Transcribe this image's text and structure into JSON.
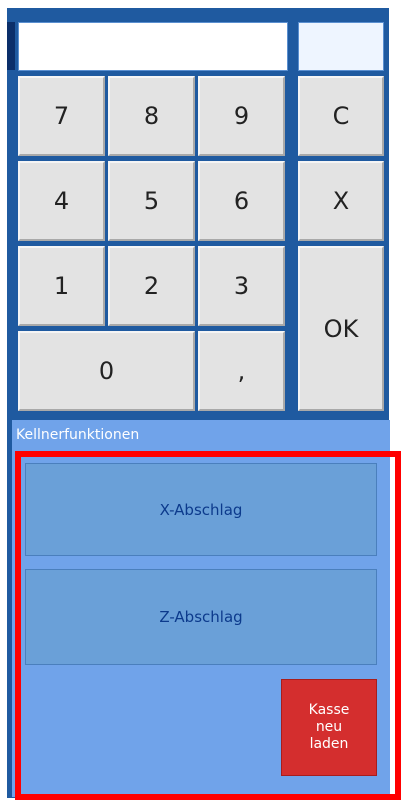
{
  "keypad": {
    "keys": {
      "k7": "7",
      "k8": "8",
      "k9": "9",
      "clear": "C",
      "k4": "4",
      "k5": "5",
      "k6": "6",
      "cancel": "X",
      "k1": "1",
      "k2": "2",
      "k3": "3",
      "ok": "OK",
      "k0": "0",
      "comma": ","
    }
  },
  "waiter_functions": {
    "heading": "Kellnerfunktionen",
    "x_abschlag": "X-Abschlag",
    "z_abschlag": "Z-Abschlag",
    "reload": "Kasse\nneu\nladen"
  },
  "colors": {
    "panel": "#1f5aa0",
    "section": "#70a3ea",
    "function_button": "#6aa0d8",
    "reload_button": "#d42e2e",
    "highlight": "#ff0000"
  }
}
